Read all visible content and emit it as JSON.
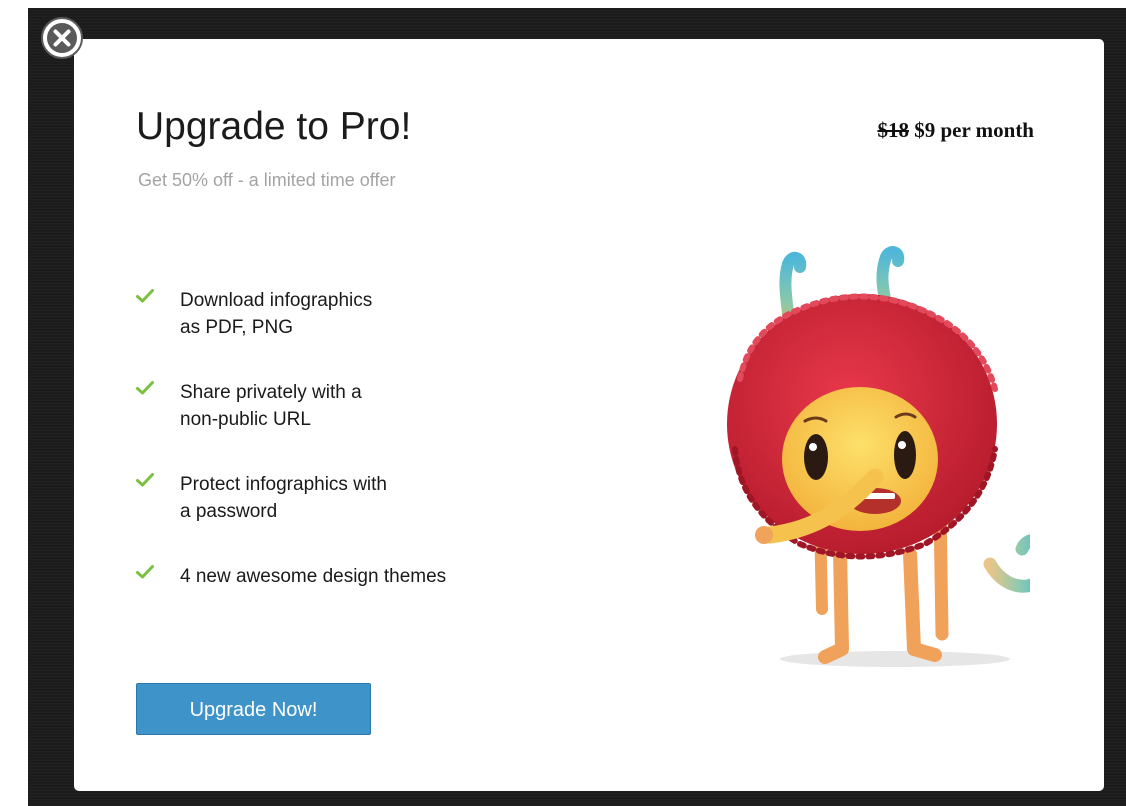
{
  "modal": {
    "title": "Upgrade to Pro!",
    "subtitle": "Get 50% off - a limited time offer",
    "price": {
      "old": "$18",
      "new": "$9 per month"
    },
    "features": [
      {
        "line1": "Download infographics",
        "line2": "as PDF, PNG"
      },
      {
        "line1": "Share privately with a",
        "line2": "non-public URL"
      },
      {
        "line1": "Protect infographics with",
        "line2": "a password"
      },
      {
        "line1": "4 new awesome design themes",
        "line2": ""
      }
    ],
    "cta_label": "Upgrade Now!",
    "colors": {
      "accent": "#3e93c8",
      "check": "#7ac142",
      "monster": "#d72a3c"
    }
  },
  "icons": {
    "close": "close-circle-icon",
    "check": "checkmark-icon"
  }
}
